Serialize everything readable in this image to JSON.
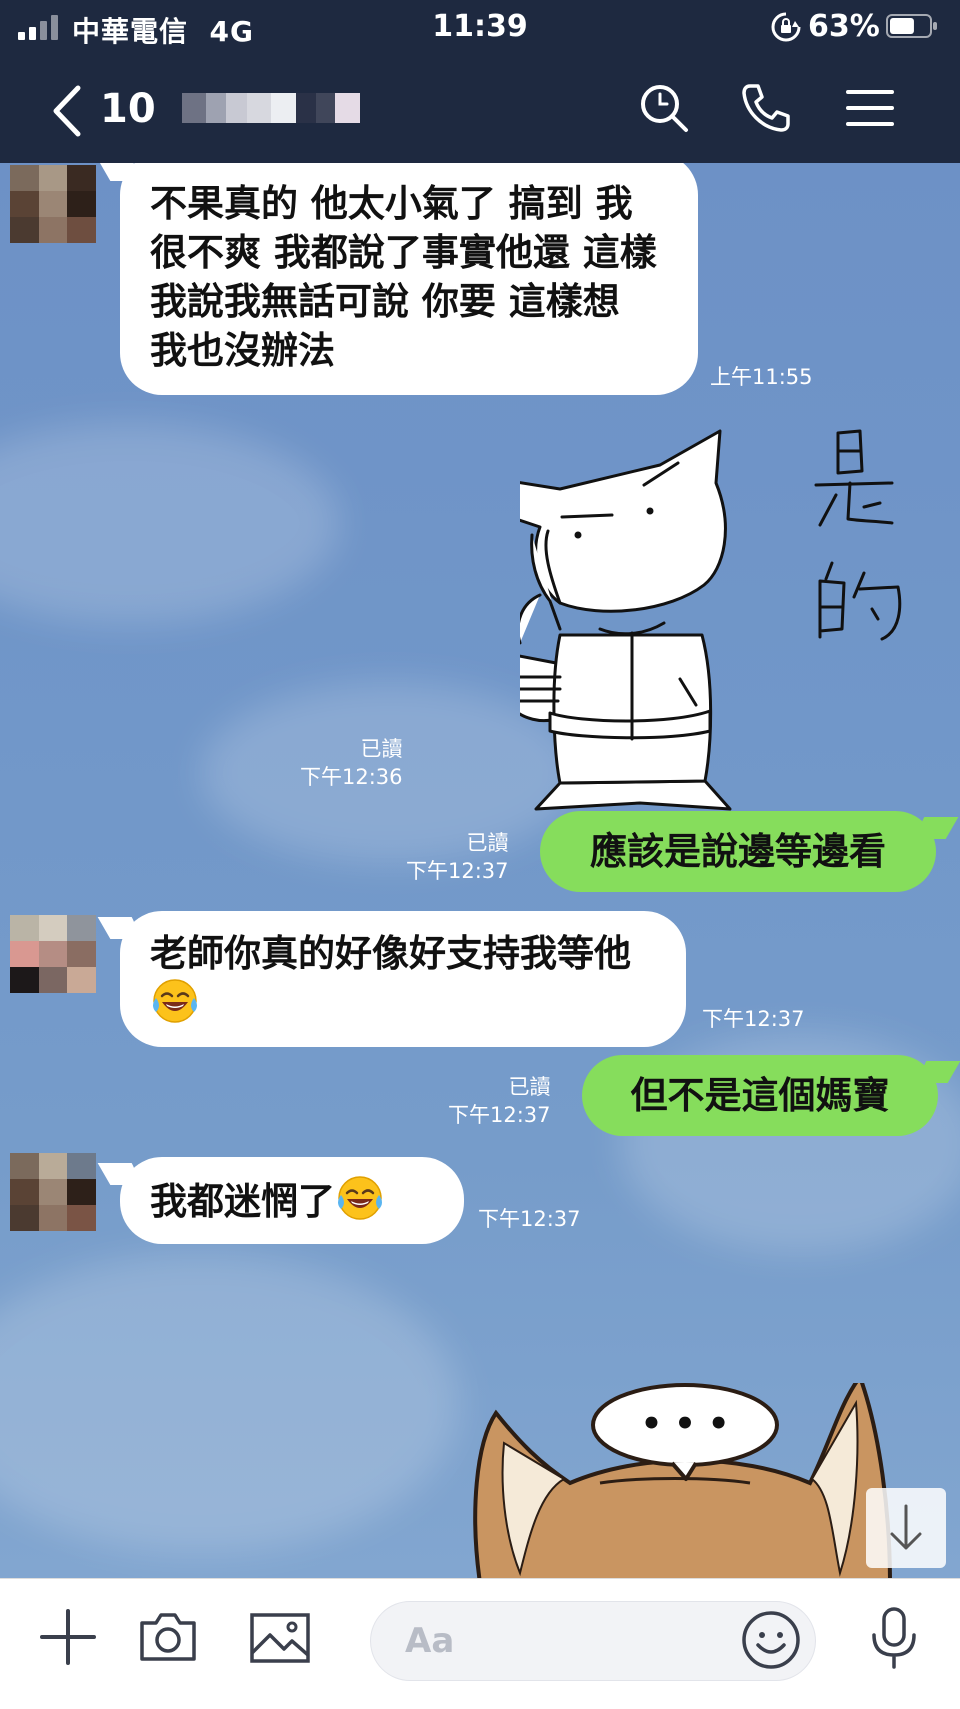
{
  "status_bar": {
    "carrier": "中華電信",
    "network": "4G",
    "time": "11:39",
    "battery_percent": "63%",
    "battery_level": 0.63
  },
  "header": {
    "back_count": "10",
    "icons": [
      "back-chevron-icon",
      "search-icon",
      "phone-icon",
      "hamburger-menu-icon"
    ]
  },
  "messages": [
    {
      "direction": "in",
      "text": "不果真的 他太小氣了 搞到 我很不爽 我都說了事實他還 這樣 我說我無話可說 你要 這樣想 我也沒辦法",
      "time": "上午11:55"
    },
    {
      "direction": "out",
      "type": "sticker",
      "sticker_text": "是的",
      "read": "已讀",
      "time": "下午12:36"
    },
    {
      "direction": "out",
      "text": "應該是說邊等邊看",
      "read": "已讀",
      "time": "下午12:37"
    },
    {
      "direction": "in",
      "text": "老師你真的好像好支持我等他",
      "emoji": "face-with-tears-of-joy",
      "time": "下午12:37"
    },
    {
      "direction": "out",
      "text": "但不是這個媽寶",
      "read": "已讀",
      "time": "下午12:37"
    },
    {
      "direction": "in",
      "text": "我都迷惘了",
      "emoji": "face-with-tears-of-joy",
      "time": "下午12:37"
    },
    {
      "direction": "in",
      "type": "sticker",
      "sticker_text": "• • •"
    }
  ],
  "input_bar": {
    "placeholder": "Aa",
    "icons": [
      "plus-icon",
      "camera-icon",
      "image-icon",
      "smile-icon",
      "microphone-icon"
    ]
  },
  "colors": {
    "header_bg": "#1e2940",
    "outgoing_bubble": "#86dd5c",
    "incoming_bubble": "#ffffff",
    "chat_bg": "#6f93c6"
  }
}
